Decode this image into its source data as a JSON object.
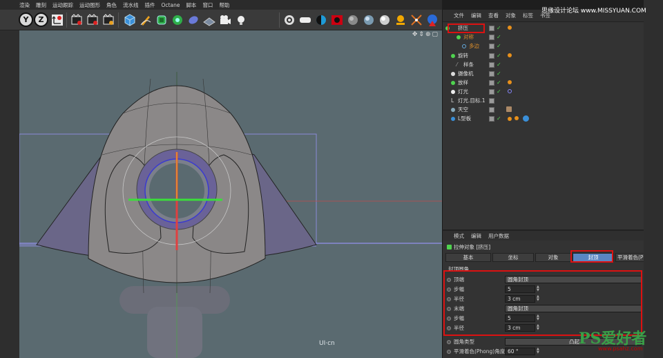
{
  "menubar": {
    "items": [
      "渲染",
      "雕刻",
      "运动跟踪",
      "运动图形",
      "角色",
      "流水线",
      "插件",
      "Octane",
      "脚本",
      "窗口",
      "帮助"
    ]
  },
  "toolbar": {
    "axis_buttons": [
      "Y",
      "Z"
    ]
  },
  "object_manager": {
    "menu": [
      "文件",
      "编辑",
      "查看",
      "对象",
      "标签",
      "书签"
    ],
    "objects": [
      {
        "name": "挤压",
        "indent": 0,
        "highlight": true
      },
      {
        "name": "对称",
        "indent": 1,
        "orange": true
      },
      {
        "name": "多边",
        "indent": 2,
        "orange": true
      },
      {
        "name": "旋转",
        "indent": 0
      },
      {
        "name": "样条",
        "indent": 1
      },
      {
        "name": "摄像机",
        "indent": 0
      },
      {
        "name": "放样",
        "indent": 0
      },
      {
        "name": "灯光",
        "indent": 0
      },
      {
        "name": "灯光.目标.1",
        "indent": 0
      },
      {
        "name": "天空",
        "indent": 0
      },
      {
        "name": "L型板",
        "indent": 0
      }
    ]
  },
  "attribute_manager": {
    "menu": [
      "模式",
      "编辑",
      "用户数据"
    ],
    "title": "拉伸对象 [挤压]",
    "tabs": [
      "基本",
      "坐标",
      "对象",
      "封顶",
      "平滑着色(Ph"
    ],
    "active_tab": "封顶",
    "section": "封顶圆角",
    "params": [
      {
        "label": "顶端",
        "value": "圆角封顶",
        "type": "dropdown"
      },
      {
        "label": "步幅",
        "value": "5",
        "type": "num"
      },
      {
        "label": "半径",
        "value": "3 cm",
        "type": "num"
      },
      {
        "label": "末端",
        "value": "圆角封顶",
        "type": "dropdown"
      },
      {
        "label": "步幅",
        "value": "5",
        "type": "num"
      },
      {
        "label": "半径",
        "value": "3 cm",
        "type": "num"
      },
      {
        "label": "圆角类型",
        "value": "凸起",
        "type": "dropdown"
      },
      {
        "label": "平滑着色(Phong)角度",
        "value": "60 °",
        "type": "num"
      }
    ]
  },
  "watermarks": {
    "top": "思缘设计论坛 www.MISSYUAN.COM",
    "bottom_logo": "PS爱好者",
    "bottom_url": "www.psahz.com",
    "viewport_logo": "UI·cn"
  },
  "colors": {
    "viewport_bg": "#5a6a70",
    "active_tab": "#5a86c2",
    "highlight_red": "#dd1111"
  }
}
